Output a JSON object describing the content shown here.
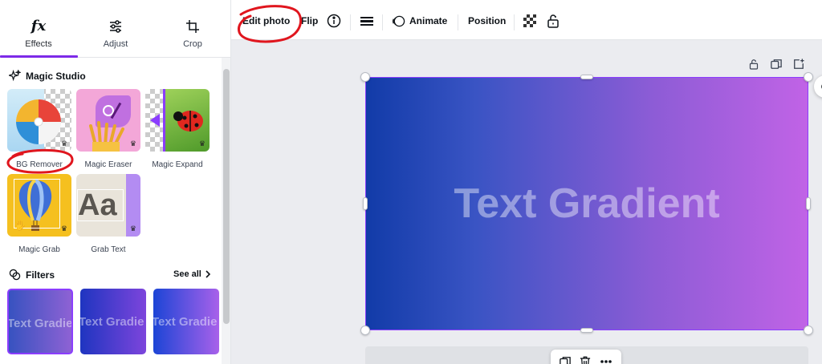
{
  "panel": {
    "tabs": [
      {
        "label": "Effects",
        "icon": "fx-icon",
        "active": true
      },
      {
        "label": "Adjust",
        "icon": "sliders-icon"
      },
      {
        "label": "Crop",
        "icon": "crop-icon"
      }
    ],
    "magic_studio": {
      "title": "Magic Studio",
      "tools": [
        {
          "label": "BG Remover",
          "icon": "beach-ball-image"
        },
        {
          "label": "Magic Eraser",
          "icon": "fries-image"
        },
        {
          "label": "Magic Expand",
          "icon": "ladybug-image"
        },
        {
          "label": "Magic Grab",
          "icon": "balloon-image"
        },
        {
          "label": "Grab Text",
          "icon": "aa-text-image",
          "glyph": "Aa"
        }
      ]
    },
    "filters": {
      "title": "Filters",
      "see_all": "See all",
      "items": [
        {
          "thumb_text": "Text Gradie",
          "selected": true
        },
        {
          "thumb_text": "Text Gradie"
        },
        {
          "thumb_text": "Text Gradie"
        }
      ]
    }
  },
  "toolbar": {
    "edit_photo": "Edit photo",
    "flip": "Flip",
    "animate": "Animate",
    "position": "Position"
  },
  "canvas": {
    "page_text": "Text Gradient"
  },
  "colors": {
    "accent": "#7d2ae8",
    "selection": "#8b3dff",
    "annotation": "#e0161e",
    "gradient_start": "#113ba8",
    "gradient_end": "#c163e6"
  }
}
